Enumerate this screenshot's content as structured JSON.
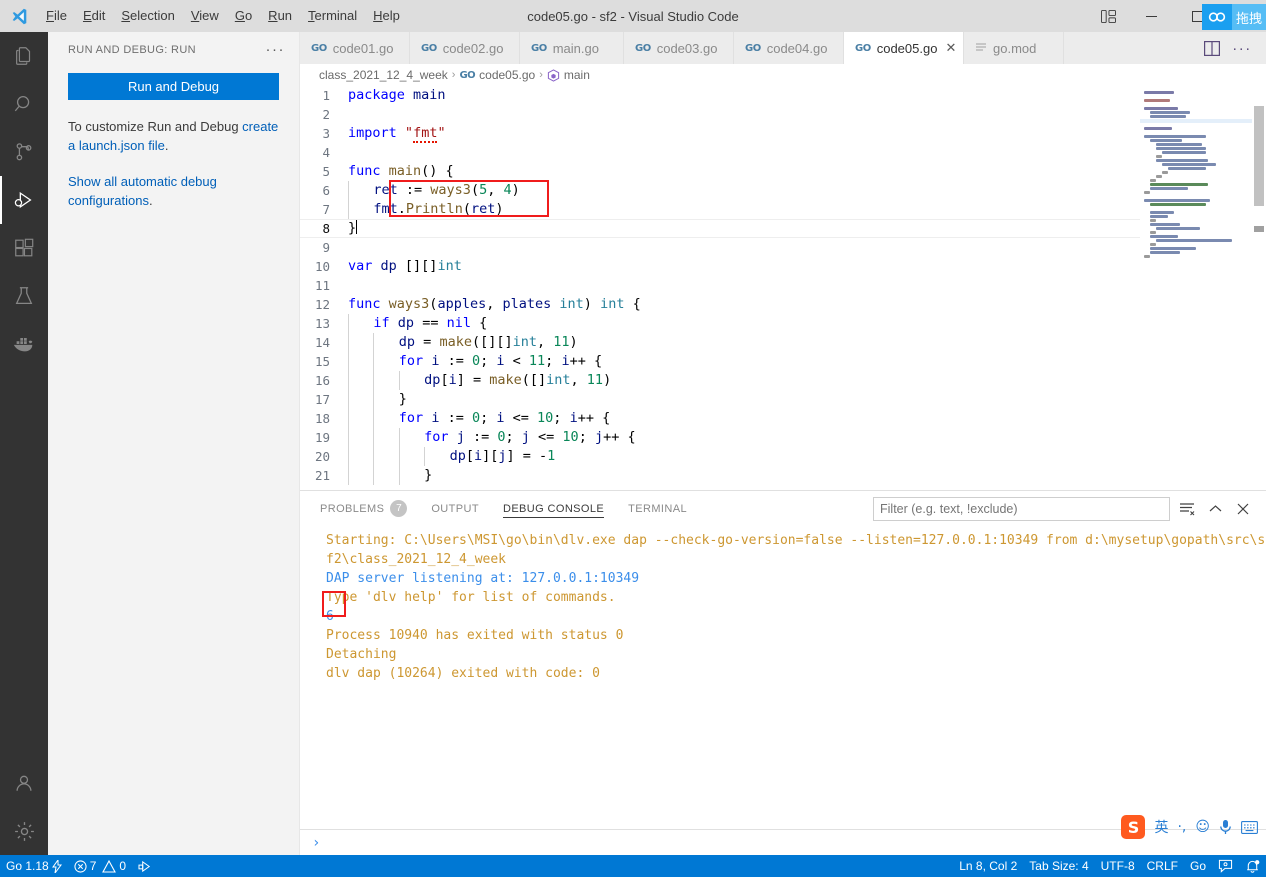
{
  "window": {
    "title": "code05.go - sf2 - Visual Studio Code",
    "menu": [
      "File",
      "Edit",
      "Selection",
      "View",
      "Go",
      "Run",
      "Terminal",
      "Help"
    ],
    "controls": {
      "layout_icon": "customize-layout-icon",
      "minimize": "minimize-icon",
      "maximize": "maximize-icon",
      "close": "close-icon"
    },
    "drag_widget_label": "拖拽"
  },
  "activity_bar": {
    "items": [
      {
        "name": "explorer",
        "icon": "files-icon"
      },
      {
        "name": "search",
        "icon": "search-icon"
      },
      {
        "name": "source-control",
        "icon": "source-control-icon"
      },
      {
        "name": "run-and-debug",
        "icon": "run-debug-icon",
        "active": true
      },
      {
        "name": "extensions",
        "icon": "extensions-icon"
      },
      {
        "name": "testing",
        "icon": "beaker-icon"
      },
      {
        "name": "docker",
        "icon": "docker-icon"
      }
    ],
    "bottom": [
      {
        "name": "accounts",
        "icon": "account-icon"
      },
      {
        "name": "settings",
        "icon": "gear-icon"
      }
    ]
  },
  "sidebar": {
    "title": "RUN AND DEBUG: RUN",
    "more_actions": "···",
    "run_button": "Run and Debug",
    "hint_prefix": "To customize Run and Debug ",
    "hint_link": "create a launch.json file",
    "hint_suffix": ".",
    "show_all_link": "Show all automatic debug configurations",
    "show_all_suffix": "."
  },
  "editor": {
    "tabs": [
      {
        "label": "code01.go",
        "icon": "go-file-icon",
        "active": false,
        "closable": false
      },
      {
        "label": "code02.go",
        "icon": "go-file-icon",
        "active": false,
        "closable": false
      },
      {
        "label": "main.go",
        "icon": "go-file-icon",
        "active": false,
        "closable": false
      },
      {
        "label": "code03.go",
        "icon": "go-file-icon",
        "active": false,
        "closable": false
      },
      {
        "label": "code04.go",
        "icon": "go-file-icon",
        "active": false,
        "closable": false
      },
      {
        "label": "code05.go",
        "icon": "go-file-icon",
        "active": true,
        "closable": true,
        "close_glyph": "✕"
      },
      {
        "label": "go.mod",
        "icon": "mod-file-icon",
        "active": false,
        "closable": false
      }
    ],
    "actions": [
      {
        "name": "split-editor-right-button",
        "icon": "split-editor-icon"
      },
      {
        "name": "more-actions-button",
        "icon": "ellipsis-icon",
        "glyph": "···"
      }
    ],
    "breadcrumbs": [
      {
        "label": "class_2021_12_4_week",
        "icon": ""
      },
      {
        "label": "code05.go",
        "icon": "go-file-icon"
      },
      {
        "label": "main",
        "icon": "symbol-namespace-icon"
      }
    ],
    "breadcrumb_separator": "›",
    "lines": [
      {
        "n": "1",
        "text": "package main"
      },
      {
        "n": "2",
        "text": ""
      },
      {
        "n": "3",
        "text": "import \"fmt\""
      },
      {
        "n": "4",
        "text": ""
      },
      {
        "n": "5",
        "text": "func main() {"
      },
      {
        "n": "6",
        "text": "    ret := ways3(5, 4)"
      },
      {
        "n": "7",
        "text": "    fmt.Println(ret)"
      },
      {
        "n": "8",
        "text": "}"
      },
      {
        "n": "9",
        "text": ""
      },
      {
        "n": "10",
        "text": "var dp [][]int"
      },
      {
        "n": "11",
        "text": ""
      },
      {
        "n": "12",
        "text": "func ways3(apples, plates int) int {"
      },
      {
        "n": "13",
        "text": "    if dp == nil {"
      },
      {
        "n": "14",
        "text": "        dp = make([][]int, 11)"
      },
      {
        "n": "15",
        "text": "        for i := 0; i < 11; i++ {"
      },
      {
        "n": "16",
        "text": "            dp[i] = make([]int, 11)"
      },
      {
        "n": "17",
        "text": "        }"
      },
      {
        "n": "18",
        "text": "        for i := 0; i <= 10; i++ {"
      },
      {
        "n": "19",
        "text": "            for j := 0; j <= 10; j++ {"
      },
      {
        "n": "20",
        "text": "                dp[i][j] = -1"
      },
      {
        "n": "21",
        "text": "            }"
      }
    ],
    "highlight_box": {
      "label": "code-highlight-annotation",
      "color": "#f01c1c"
    },
    "cursor_line": "8"
  },
  "panel": {
    "tabs": [
      {
        "label": "PROBLEMS",
        "badge": "7",
        "active": false
      },
      {
        "label": "OUTPUT",
        "badge": "",
        "active": false
      },
      {
        "label": "DEBUG CONSOLE",
        "badge": "",
        "active": true
      },
      {
        "label": "TERMINAL",
        "badge": "",
        "active": false
      }
    ],
    "filter_placeholder": "Filter (e.g. text, !exclude)",
    "filter_value": "",
    "actions": [
      {
        "name": "clear-console-button",
        "icon": "clear-all-icon"
      },
      {
        "name": "maximize-panel-button",
        "icon": "chevron-up-icon",
        "glyph": "⌃"
      },
      {
        "name": "close-panel-button",
        "icon": "close-icon",
        "glyph": "✕"
      }
    ],
    "console_lines": [
      {
        "text": "Starting: C:\\Users\\MSI\\go\\bin\\dlv.exe dap --check-go-version=false --listen=127.0.0.1:10349 from d:\\mysetup\\gopath\\src\\s",
        "color": "orange"
      },
      {
        "text": "f2\\class_2021_12_4_week",
        "color": "orange"
      },
      {
        "text": "DAP server listening at: 127.0.0.1:10349",
        "color": "blue"
      },
      {
        "text": "Type 'dlv help' for list of commands.",
        "color": "orange"
      },
      {
        "text": "6",
        "color": "blue",
        "highlighted": true
      },
      {
        "text": "Process 10940 has exited with status 0",
        "color": "orange"
      },
      {
        "text": "Detaching",
        "color": "orange"
      },
      {
        "text": "dlv dap (10264) exited with code: 0",
        "color": "orange"
      }
    ],
    "repl_prompt": "›",
    "repl_value": ""
  },
  "ime": {
    "logo": "S",
    "items": [
      "英",
      "·,",
      "☺",
      "mic-icon",
      "keyboard-icon"
    ]
  },
  "status_bar": {
    "left": [
      {
        "name": "go-version",
        "label": "Go 1.18",
        "icon": "lightning-icon"
      },
      {
        "name": "problems",
        "label": "7",
        "label2": "0",
        "icon": "error-icon",
        "icon2": "warning-icon"
      },
      {
        "name": "go-test",
        "label": "",
        "icon": "run-test-icon"
      }
    ],
    "right": [
      {
        "name": "editor-position",
        "label": "Ln 8, Col 2"
      },
      {
        "name": "tab-size",
        "label": "Tab Size: 4"
      },
      {
        "name": "encoding",
        "label": "UTF-8"
      },
      {
        "name": "eol",
        "label": "CRLF"
      },
      {
        "name": "language-mode",
        "label": "Go"
      },
      {
        "name": "feedback",
        "label": "",
        "icon": "feedback-icon"
      },
      {
        "name": "notifications",
        "label": "",
        "icon": "bell-dot-icon"
      }
    ]
  },
  "colors": {
    "accent": "#0078d4",
    "titlebar": "#dddddd",
    "sidebar": "#f3f3f3",
    "activitybar": "#333333",
    "annotation_red": "#f01c1c",
    "console_orange": "#cd9731",
    "console_blue": "#3b8eea"
  }
}
